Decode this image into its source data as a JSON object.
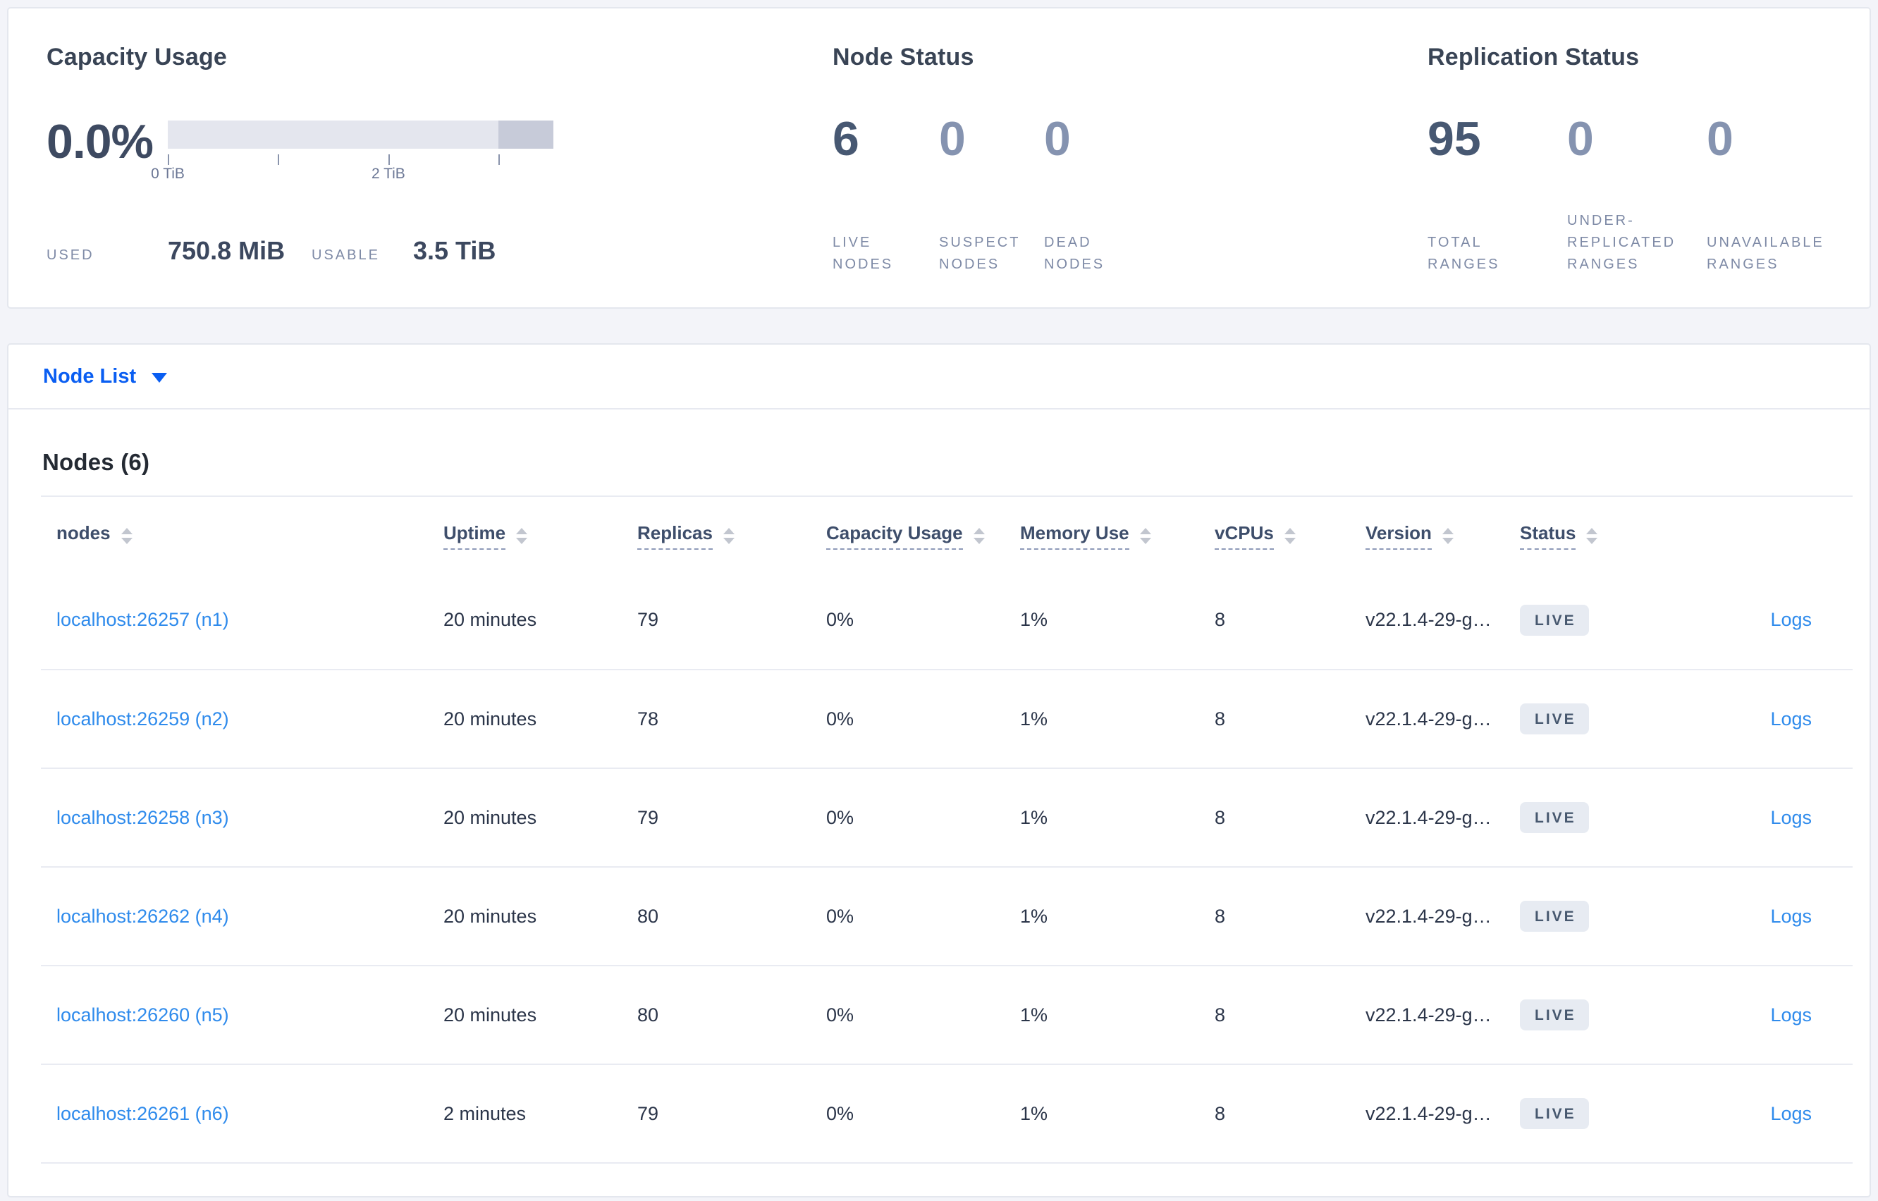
{
  "colors": {
    "accent_blue": "#0a5ef2",
    "link_blue": "#2f8bec",
    "badge_bg": "#e7ebf2",
    "badge_text": "#47586f",
    "bar_track": "#e4e6ee",
    "bar_dark_segment": "#c7cbd9"
  },
  "summary": {
    "capacity": {
      "title": "Capacity Usage",
      "percent": "0.0%",
      "used_label": "USED",
      "used_value": "750.8 MiB",
      "usable_label": "USABLE",
      "usable_value": "3.5 TiB",
      "bar": {
        "total_tib": 3.5,
        "used_fraction": 0.0,
        "dark_segment_start_pct": 85.7,
        "ticks": [
          {
            "pos_pct": 0,
            "label": "0 TiB"
          },
          {
            "pos_pct": 28.6,
            "label": ""
          },
          {
            "pos_pct": 57.2,
            "label": "2 TiB"
          },
          {
            "pos_pct": 85.7,
            "label": ""
          }
        ]
      }
    },
    "node_status": {
      "title": "Node Status",
      "metrics": [
        {
          "value": "6",
          "label": "LIVE NODES",
          "emph": true
        },
        {
          "value": "0",
          "label": "SUSPECT NODES",
          "emph": false
        },
        {
          "value": "0",
          "label": "DEAD NODES",
          "emph": false
        }
      ]
    },
    "replication": {
      "title": "Replication Status",
      "metrics": [
        {
          "value": "95",
          "label": "TOTAL RANGES",
          "emph": true
        },
        {
          "value": "0",
          "label": "UNDER-REPLICATED RANGES",
          "emph": false
        },
        {
          "value": "0",
          "label": "UNAVAILABLE RANGES",
          "emph": false
        }
      ]
    }
  },
  "node_list": {
    "toggle_label": "Node List"
  },
  "nodes_section": {
    "title": "Nodes (6)",
    "columns": [
      {
        "label": "nodes",
        "sortable": true,
        "tooltip": false
      },
      {
        "label": "Uptime",
        "sortable": true,
        "tooltip": true
      },
      {
        "label": "Replicas",
        "sortable": true,
        "tooltip": true
      },
      {
        "label": "Capacity Usage",
        "sortable": true,
        "tooltip": true
      },
      {
        "label": "Memory Use",
        "sortable": true,
        "tooltip": true
      },
      {
        "label": "vCPUs",
        "sortable": true,
        "tooltip": true
      },
      {
        "label": "Version",
        "sortable": true,
        "tooltip": true
      },
      {
        "label": "Status",
        "sortable": true,
        "tooltip": true
      },
      {
        "label": "",
        "sortable": false,
        "tooltip": false
      }
    ],
    "rows": [
      {
        "node": "localhost:26257 (n1)",
        "uptime": "20 minutes",
        "replicas": "79",
        "capacity": "0%",
        "memory": "1%",
        "vcpus": "8",
        "version": "v22.1.4-29-g…",
        "status": "LIVE",
        "logs": "Logs"
      },
      {
        "node": "localhost:26259 (n2)",
        "uptime": "20 minutes",
        "replicas": "78",
        "capacity": "0%",
        "memory": "1%",
        "vcpus": "8",
        "version": "v22.1.4-29-g…",
        "status": "LIVE",
        "logs": "Logs"
      },
      {
        "node": "localhost:26258 (n3)",
        "uptime": "20 minutes",
        "replicas": "79",
        "capacity": "0%",
        "memory": "1%",
        "vcpus": "8",
        "version": "v22.1.4-29-g…",
        "status": "LIVE",
        "logs": "Logs"
      },
      {
        "node": "localhost:26262 (n4)",
        "uptime": "20 minutes",
        "replicas": "80",
        "capacity": "0%",
        "memory": "1%",
        "vcpus": "8",
        "version": "v22.1.4-29-g…",
        "status": "LIVE",
        "logs": "Logs"
      },
      {
        "node": "localhost:26260 (n5)",
        "uptime": "20 minutes",
        "replicas": "80",
        "capacity": "0%",
        "memory": "1%",
        "vcpus": "8",
        "version": "v22.1.4-29-g…",
        "status": "LIVE",
        "logs": "Logs"
      },
      {
        "node": "localhost:26261 (n6)",
        "uptime": "2 minutes",
        "replicas": "79",
        "capacity": "0%",
        "memory": "1%",
        "vcpus": "8",
        "version": "v22.1.4-29-g…",
        "status": "LIVE",
        "logs": "Logs"
      }
    ]
  }
}
